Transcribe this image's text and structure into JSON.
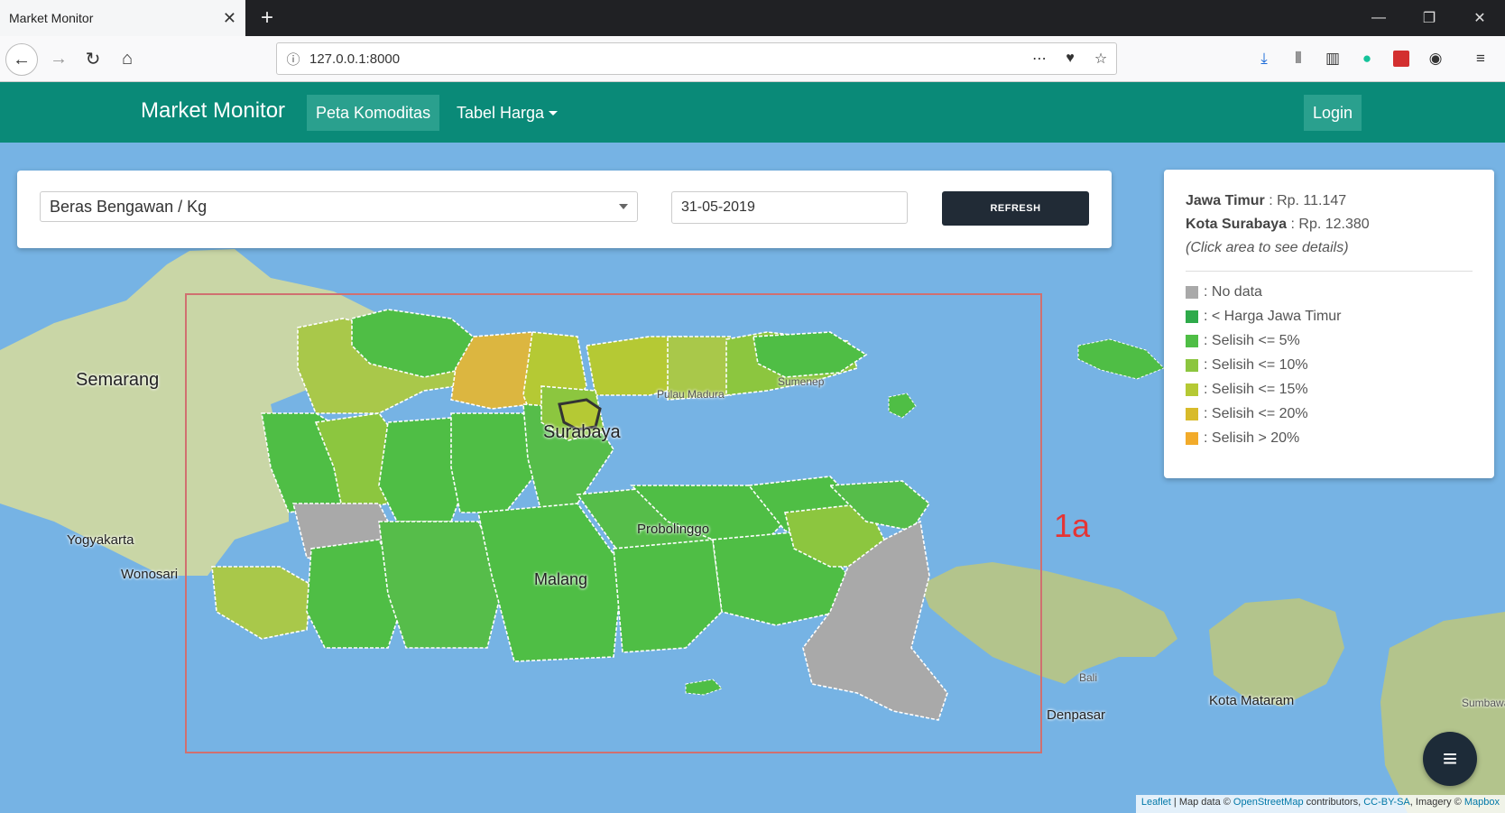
{
  "browser": {
    "tab_title": "Market Monitor",
    "tab_close": "✕",
    "new_tab": "+",
    "url": "127.0.0.1:8000",
    "win_minimize": "—",
    "win_restore": "❐",
    "win_close": "✕"
  },
  "app": {
    "brand": "Market Monitor",
    "nav": [
      {
        "label": "Peta Komoditas",
        "active": true
      },
      {
        "label": "Tabel Harga",
        "dropdown": true
      }
    ],
    "login": "Login"
  },
  "controls": {
    "commodity": "Beras Bengawan / Kg",
    "date": "31-05-2019",
    "refresh": "REFRESH"
  },
  "info": {
    "province_name": "Jawa Timur",
    "province_price": " : Rp. 11.147",
    "city_name": "Kota Surabaya",
    "city_price": " : Rp. 12.380",
    "hint": "(Click area to see details)"
  },
  "legend": [
    {
      "label": ": No data",
      "color": "#a9a9a9"
    },
    {
      "label": ": < Harga Jawa Timur",
      "color": "#2eaa4a"
    },
    {
      "label": ": Selisih <= 5%",
      "color": "#4fbe45"
    },
    {
      "label": ": Selisih <= 10%",
      "color": "#8cc63f"
    },
    {
      "label": ": Selisih <= 15%",
      "color": "#b5c934"
    },
    {
      "label": ": Selisih <= 20%",
      "color": "#d8bb2a"
    },
    {
      "label": ": Selisih > 20%",
      "color": "#f2ab2a"
    }
  ],
  "map_labels": {
    "semarang": "Semarang",
    "yogyakarta": "Yogyakarta",
    "wonosari": "Wonosari",
    "surabaya": "Surabaya",
    "probolinggo": "Probolinggo",
    "malang": "Malang",
    "sumenep": "Sumenep",
    "pulau_madura": "Pulau Madura",
    "bali": "Bali",
    "denpasar": "Denpasar",
    "mataram": "Kota Mataram",
    "sumbawa": "Sumbawa"
  },
  "annotation": "1a",
  "attribution": {
    "leaflet": "Leaflet",
    "text1": " | Map data © ",
    "osm": "OpenStreetMap",
    "text2": " contributors, ",
    "license": "CC-BY-SA",
    "text3": ", Imagery © ",
    "mapbox": "Mapbox"
  },
  "fab_icon": "menu-icon"
}
